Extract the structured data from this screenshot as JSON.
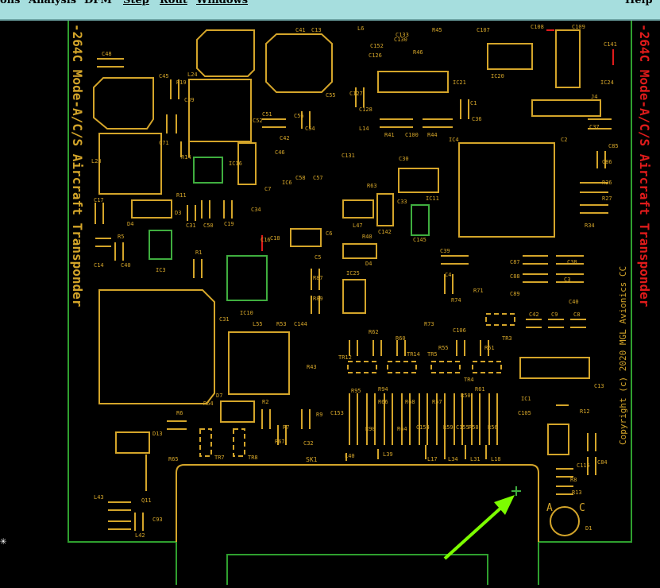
{
  "menubar": {
    "items": [
      {
        "id": "options",
        "label": "ons"
      },
      {
        "id": "analysis",
        "label": "Analysis"
      },
      {
        "id": "dfm",
        "label": "DFM"
      },
      {
        "id": "step",
        "label": "Step"
      },
      {
        "id": "route",
        "label": "Rout"
      },
      {
        "id": "windows",
        "label": "Windows"
      },
      {
        "id": "help",
        "label": "Help"
      }
    ]
  },
  "board": {
    "silk_left": "-264C Mode-A/C/S Aircraft Transponder",
    "silk_right": "-264C Mode-A/C/S Aircraft Transponder",
    "copyright": "Copyright (c) 2020 MGL Avionics CC",
    "connector_label": "SK1",
    "diode_labels": {
      "anode": "A",
      "cathode": "C",
      "ref": "D1"
    },
    "colors": {
      "outline": "#2fa02f",
      "silk": "#d4a52a",
      "pad": "#3fae3f",
      "highlight": "#e01b1b",
      "arrow": "#7cfc00"
    }
  },
  "components": [
    {
      "ref": "C48"
    },
    {
      "ref": "C45"
    },
    {
      "ref": "R19"
    },
    {
      "ref": "C39"
    },
    {
      "ref": "L24"
    },
    {
      "ref": "C71"
    },
    {
      "ref": "L23"
    },
    {
      "ref": "R11"
    },
    {
      "ref": "C17"
    },
    {
      "ref": "IC16"
    },
    {
      "ref": "R14"
    },
    {
      "ref": "C34"
    },
    {
      "ref": "C7"
    },
    {
      "ref": "IC6"
    },
    {
      "ref": "C58"
    },
    {
      "ref": "C57"
    },
    {
      "ref": "C46"
    },
    {
      "ref": "C42"
    },
    {
      "ref": "C56"
    },
    {
      "ref": "C51"
    },
    {
      "ref": "C54"
    },
    {
      "ref": "C55"
    },
    {
      "ref": "C52"
    },
    {
      "ref": "C41"
    },
    {
      "ref": "C13"
    },
    {
      "ref": "C131"
    },
    {
      "ref": "C127"
    },
    {
      "ref": "C128"
    },
    {
      "ref": "C152"
    },
    {
      "ref": "C126"
    },
    {
      "ref": "C133"
    },
    {
      "ref": "C130"
    },
    {
      "ref": "R45"
    },
    {
      "ref": "R46"
    },
    {
      "ref": "L6"
    },
    {
      "ref": "L14"
    },
    {
      "ref": "R41"
    },
    {
      "ref": "C100"
    },
    {
      "ref": "R44"
    },
    {
      "ref": "IC21"
    },
    {
      "ref": "C1"
    },
    {
      "ref": "C36"
    },
    {
      "ref": "IC4"
    },
    {
      "ref": "C107"
    },
    {
      "ref": "C108"
    },
    {
      "ref": "IC20"
    },
    {
      "ref": "C109"
    },
    {
      "ref": "C141"
    },
    {
      "ref": "IC24"
    },
    {
      "ref": "J4"
    },
    {
      "ref": "C37"
    },
    {
      "ref": "C2"
    },
    {
      "ref": "C85"
    },
    {
      "ref": "C86"
    },
    {
      "ref": "R26"
    },
    {
      "ref": "R27"
    },
    {
      "ref": "R34"
    },
    {
      "ref": "C30"
    },
    {
      "ref": "R63"
    },
    {
      "ref": "C33"
    },
    {
      "ref": "IC11"
    },
    {
      "ref": "L47"
    },
    {
      "ref": "C142"
    },
    {
      "ref": "C145"
    },
    {
      "ref": "C6"
    },
    {
      "ref": "R40"
    },
    {
      "ref": "C5"
    },
    {
      "ref": "D4"
    },
    {
      "ref": "C16"
    },
    {
      "ref": "C18"
    },
    {
      "ref": "C31"
    },
    {
      "ref": "C50"
    },
    {
      "ref": "C19"
    },
    {
      "ref": "D4"
    },
    {
      "ref": "D3"
    },
    {
      "ref": "R5"
    },
    {
      "ref": "C14"
    },
    {
      "ref": "C40"
    },
    {
      "ref": "IC3"
    },
    {
      "ref": "R1"
    },
    {
      "ref": "IC10"
    },
    {
      "ref": "R87"
    },
    {
      "ref": "R89"
    },
    {
      "ref": "IC25"
    },
    {
      "ref": "C3"
    },
    {
      "ref": "C4"
    },
    {
      "ref": "C39"
    },
    {
      "ref": "C87"
    },
    {
      "ref": "C88"
    },
    {
      "ref": "C89"
    },
    {
      "ref": "C38"
    },
    {
      "ref": "C40"
    },
    {
      "ref": "C42"
    },
    {
      "ref": "C9"
    },
    {
      "ref": "C8"
    },
    {
      "ref": "R74"
    },
    {
      "ref": "R71"
    },
    {
      "ref": "R73"
    },
    {
      "ref": "C106"
    },
    {
      "ref": "TR3"
    },
    {
      "ref": "C31"
    },
    {
      "ref": "L55"
    },
    {
      "ref": "R53"
    },
    {
      "ref": "C144"
    },
    {
      "ref": "R62"
    },
    {
      "ref": "R60"
    },
    {
      "ref": "R55"
    },
    {
      "ref": "R51"
    },
    {
      "ref": "TR14"
    },
    {
      "ref": "TR5"
    },
    {
      "ref": "TR12"
    },
    {
      "ref": "R43"
    },
    {
      "ref": "TR4"
    },
    {
      "ref": "C13"
    },
    {
      "ref": "D7"
    },
    {
      "ref": "R64"
    },
    {
      "ref": "R2"
    },
    {
      "ref": "R9"
    },
    {
      "ref": "R6"
    },
    {
      "ref": "R7"
    },
    {
      "ref": "C32"
    },
    {
      "ref": "R67"
    },
    {
      "ref": "D13"
    },
    {
      "ref": "R65"
    },
    {
      "ref": "TR7"
    },
    {
      "ref": "TR8"
    },
    {
      "ref": "R95"
    },
    {
      "ref": "R94"
    },
    {
      "ref": "R66"
    },
    {
      "ref": "R68"
    },
    {
      "ref": "R57"
    },
    {
      "ref": "R61"
    },
    {
      "ref": "R50"
    },
    {
      "ref": "C153"
    },
    {
      "ref": "R90"
    },
    {
      "ref": "R64"
    },
    {
      "ref": "C154"
    },
    {
      "ref": "R59"
    },
    {
      "ref": "C155"
    },
    {
      "ref": "R58"
    },
    {
      "ref": "R56"
    },
    {
      "ref": "IC1"
    },
    {
      "ref": "C105"
    },
    {
      "ref": "R12"
    },
    {
      "ref": "L40"
    },
    {
      "ref": "L39"
    },
    {
      "ref": "L17"
    },
    {
      "ref": "L34"
    },
    {
      "ref": "L31"
    },
    {
      "ref": "L18"
    },
    {
      "ref": "C115"
    },
    {
      "ref": "C84"
    },
    {
      "ref": "R8"
    },
    {
      "ref": "R13"
    },
    {
      "ref": "L43"
    },
    {
      "ref": "Q11"
    },
    {
      "ref": "C93"
    },
    {
      "ref": "L42"
    }
  ]
}
